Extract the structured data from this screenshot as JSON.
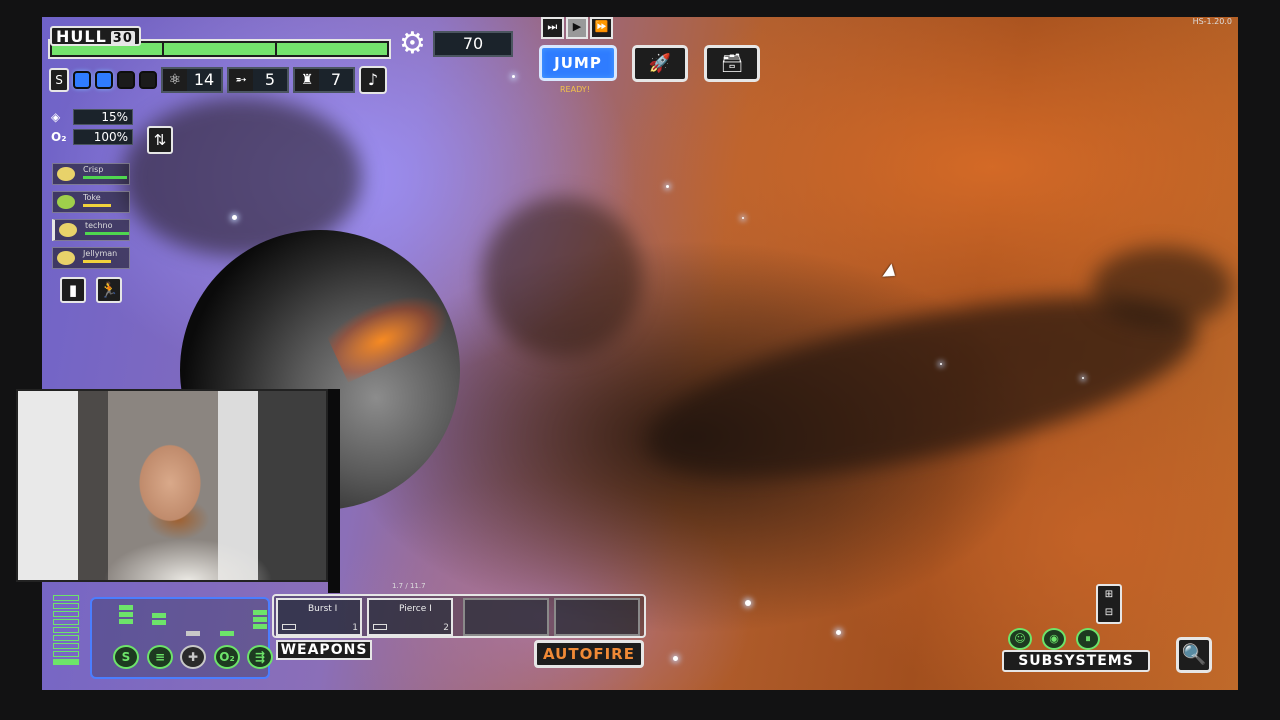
{
  "version": "HS-1.20.0",
  "hull": {
    "label": "HULL",
    "value": "30"
  },
  "scrap": {
    "icon": "gear-icon",
    "value": "70"
  },
  "shields": {
    "label": "S",
    "pips_on": 2,
    "pips_total": 4
  },
  "resources": [
    {
      "icon": "fuel-icon",
      "value": "14"
    },
    {
      "icon": "missile-icon",
      "value": "5"
    },
    {
      "icon": "drone-icon",
      "value": "7"
    }
  ],
  "music_icon": "♪",
  "evasion": {
    "icon": "evasion-icon",
    "value": "15%"
  },
  "oxygen": {
    "label": "O₂",
    "value": "100%"
  },
  "crew": [
    {
      "name": "Crisp",
      "hp": 0.95,
      "color": "#4fd64f"
    },
    {
      "name": "Toke",
      "hp": 0.6,
      "color": "#f0d23c"
    },
    {
      "name": "techno",
      "hp": 0.95,
      "color": "#4fd64f",
      "selected": true
    },
    {
      "name": "Jellyman",
      "hp": 0.6,
      "color": "#f0d23c"
    }
  ],
  "time_controls": {
    "step": "⏭",
    "play": "▶",
    "fast": "⏩"
  },
  "jump": {
    "label": "JUMP",
    "status": "READY!"
  },
  "ship_icon": "ship-icon",
  "store_icon": "store-icon",
  "systems": {
    "power_bars_on": 1,
    "power_bars_total": 9,
    "items": [
      {
        "label": "S",
        "name": "shields",
        "power": 2
      },
      {
        "label": "≡",
        "name": "engines",
        "power": 2
      },
      {
        "label": "✚",
        "name": "medbay",
        "power": 0,
        "off": true
      },
      {
        "label": "O₂",
        "name": "oxygen",
        "power": 1
      },
      {
        "label": "⇶",
        "name": "weapons",
        "power": 3
      }
    ]
  },
  "weapons": {
    "label": "WEAPONS",
    "autofire": "AUTOFIRE",
    "ratio": "1.7 / 11.7",
    "slots": [
      {
        "name": "Burst I",
        "num": "1"
      },
      {
        "name": "Pierce I",
        "num": "2"
      },
      {
        "name": "",
        "num": ""
      },
      {
        "name": "",
        "num": ""
      }
    ]
  },
  "subsystems": {
    "label": "SUBSYSTEMS"
  }
}
